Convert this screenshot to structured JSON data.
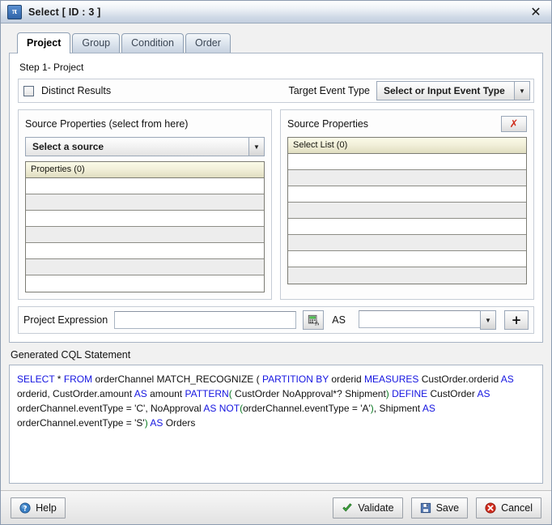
{
  "window": {
    "title": "Select [ ID : 3 ]",
    "icon": "pi-icon",
    "close_label": "✕"
  },
  "tabs": [
    {
      "label": "Project",
      "active": true
    },
    {
      "label": "Group",
      "active": false
    },
    {
      "label": "Condition",
      "active": false
    },
    {
      "label": "Order",
      "active": false
    }
  ],
  "project_tab": {
    "step_label": "Step 1- Project",
    "distinct": {
      "label": "Distinct Results",
      "checked": false
    },
    "target_event_type": {
      "label": "Target Event Type",
      "value": "Select or Input Event Type",
      "arrow": "▼"
    },
    "source_panel": {
      "title": "Source Properties (select from here)",
      "source_combo": {
        "value": "Select a source",
        "arrow": "▼"
      },
      "list_header": "Properties (0)",
      "rows": [
        "",
        "",
        "",
        "",
        "",
        "",
        ""
      ]
    },
    "select_panel": {
      "title": "Source Properties",
      "delete_button": "✗",
      "list_header": "Select List (0)",
      "rows": [
        "",
        "",
        "",
        "",
        "",
        "",
        "",
        ""
      ]
    },
    "expression_row": {
      "label": "Project Expression",
      "value": "",
      "fx_button": "expression-builder-icon",
      "as_label": "AS",
      "alias_value": "",
      "alias_arrow": "▼",
      "add_button": "+"
    }
  },
  "cql": {
    "label": "Generated CQL Statement",
    "statement_plain": "SELECT * FROM orderChannel  MATCH_RECOGNIZE ( PARTITION BY orderid MEASURES CustOrder.orderid AS orderid, CustOrder.amount AS amount PATTERN( CustOrder NoApproval*? Shipment) DEFINE CustOrder AS orderChannel.eventType = 'C', NoApproval AS NOT(orderChannel.eventType = 'A'), Shipment AS orderChannel.eventType = 'S') AS Orders",
    "tokens": [
      {
        "t": "SELECT",
        "c": "kw"
      },
      {
        "t": " * ",
        "c": ""
      },
      {
        "t": "FROM",
        "c": "kw"
      },
      {
        "t": " orderChannel  MATCH_RECOGNIZE ( ",
        "c": ""
      },
      {
        "t": "PARTITION BY",
        "c": "kw"
      },
      {
        "t": " orderid ",
        "c": ""
      },
      {
        "t": "MEASURES",
        "c": "kw"
      },
      {
        "t": " CustOrder.orderid ",
        "c": ""
      },
      {
        "t": "AS",
        "c": "kw"
      },
      {
        "t": " orderid, CustOrder.amount ",
        "c": ""
      },
      {
        "t": "AS",
        "c": "kw"
      },
      {
        "t": " amount ",
        "c": ""
      },
      {
        "t": "PATTERN",
        "c": "kw"
      },
      {
        "t": "(",
        "c": "kwg"
      },
      {
        "t": " CustOrder NoApproval*? Shipment",
        "c": ""
      },
      {
        "t": ")",
        "c": "kwg"
      },
      {
        "t": " ",
        "c": ""
      },
      {
        "t": "DEFINE",
        "c": "kw"
      },
      {
        "t": " CustOrder ",
        "c": ""
      },
      {
        "t": "AS",
        "c": "kw"
      },
      {
        "t": " orderChannel.eventType = 'C', NoApproval ",
        "c": ""
      },
      {
        "t": "AS",
        "c": "kw"
      },
      {
        "t": " ",
        "c": ""
      },
      {
        "t": "NOT",
        "c": "kw"
      },
      {
        "t": "(",
        "c": "kwg"
      },
      {
        "t": "orderChannel.eventType = 'A'",
        "c": ""
      },
      {
        "t": ")",
        "c": "kwg"
      },
      {
        "t": ", Shipment ",
        "c": ""
      },
      {
        "t": "AS",
        "c": "kw"
      },
      {
        "t": " orderChannel.eventType = 'S'",
        "c": ""
      },
      {
        "t": ")",
        "c": "kwg"
      },
      {
        "t": " ",
        "c": ""
      },
      {
        "t": "AS",
        "c": "kw"
      },
      {
        "t": " Orders",
        "c": ""
      }
    ]
  },
  "footer": {
    "help": "Help",
    "validate": "Validate",
    "save": "Save",
    "cancel": "Cancel"
  }
}
